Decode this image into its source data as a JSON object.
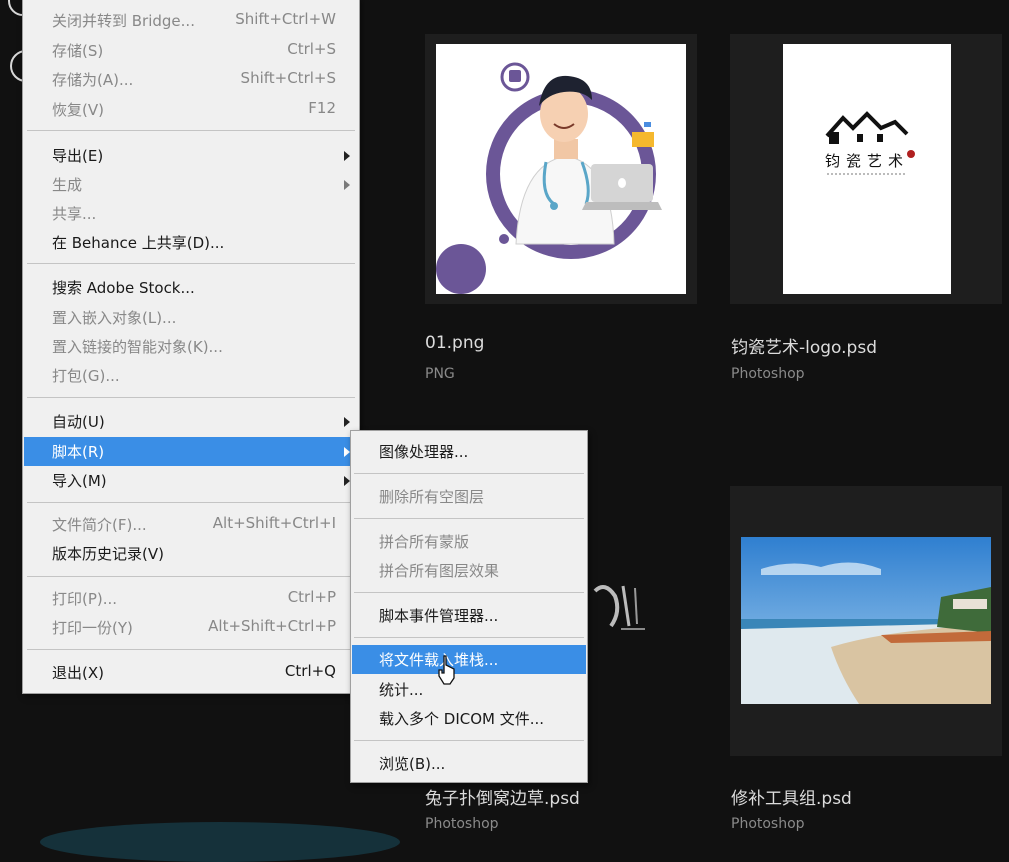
{
  "file_menu": {
    "items": [
      {
        "label": "关闭并转到 Bridge...",
        "shortcut": "Shift+Ctrl+W",
        "enabled": false
      },
      {
        "label": "存储(S)",
        "shortcut": "Ctrl+S",
        "enabled": false
      },
      {
        "label": "存储为(A)...",
        "shortcut": "Shift+Ctrl+S",
        "enabled": false
      },
      {
        "label": "恢复(V)",
        "shortcut": "F12",
        "enabled": false
      },
      {
        "label": "导出(E)",
        "shortcut": "",
        "enabled": true,
        "submenu": true
      },
      {
        "label": "生成",
        "shortcut": "",
        "enabled": false,
        "submenu": true
      },
      {
        "label": "共享...",
        "shortcut": "",
        "enabled": false
      },
      {
        "label": "在 Behance 上共享(D)...",
        "shortcut": "",
        "enabled": true
      },
      {
        "label": "搜索 Adobe Stock...",
        "shortcut": "",
        "enabled": true
      },
      {
        "label": "置入嵌入对象(L)...",
        "shortcut": "",
        "enabled": false
      },
      {
        "label": "置入链接的智能对象(K)...",
        "shortcut": "",
        "enabled": false
      },
      {
        "label": "打包(G)...",
        "shortcut": "",
        "enabled": false
      },
      {
        "label": "自动(U)",
        "shortcut": "",
        "enabled": true,
        "submenu": true
      },
      {
        "label": "脚本(R)",
        "shortcut": "",
        "enabled": true,
        "submenu": true,
        "selected": true
      },
      {
        "label": "导入(M)",
        "shortcut": "",
        "enabled": true,
        "submenu": true
      },
      {
        "label": "文件简介(F)...",
        "shortcut": "Alt+Shift+Ctrl+I",
        "enabled": false
      },
      {
        "label": "版本历史记录(V)",
        "shortcut": "",
        "enabled": true
      },
      {
        "label": "打印(P)...",
        "shortcut": "Ctrl+P",
        "enabled": false
      },
      {
        "label": "打印一份(Y)",
        "shortcut": "Alt+Shift+Ctrl+P",
        "enabled": false
      },
      {
        "label": "退出(X)",
        "shortcut": "Ctrl+Q",
        "enabled": true
      }
    ]
  },
  "scripts_menu": {
    "items": [
      {
        "label": "图像处理器...",
        "enabled": true
      },
      {
        "label": "删除所有空图层",
        "enabled": false
      },
      {
        "label": "拼合所有蒙版",
        "enabled": false
      },
      {
        "label": "拼合所有图层效果",
        "enabled": false
      },
      {
        "label": "脚本事件管理器...",
        "enabled": true
      },
      {
        "label": "将文件载入堆栈...",
        "enabled": true,
        "selected": true
      },
      {
        "label": "统计...",
        "enabled": true
      },
      {
        "label": "载入多个 DICOM 文件...",
        "enabled": true
      },
      {
        "label": "浏览(B)...",
        "enabled": true
      }
    ]
  },
  "files": [
    {
      "name": "01.png",
      "type": "PNG"
    },
    {
      "name": "钧瓷艺术-logo.psd",
      "type": "Photoshop"
    },
    {
      "name": "兔子扑倒窝边草.psd",
      "type": "Photoshop"
    },
    {
      "name": "修补工具组.psd",
      "type": "Photoshop"
    }
  ],
  "logo_text": "钧瓷艺术",
  "colors": {
    "highlight": "#3a8ee6",
    "menu_bg": "#f0f0f0",
    "page_bg": "#111111",
    "card_bg": "#1e1e1e"
  }
}
